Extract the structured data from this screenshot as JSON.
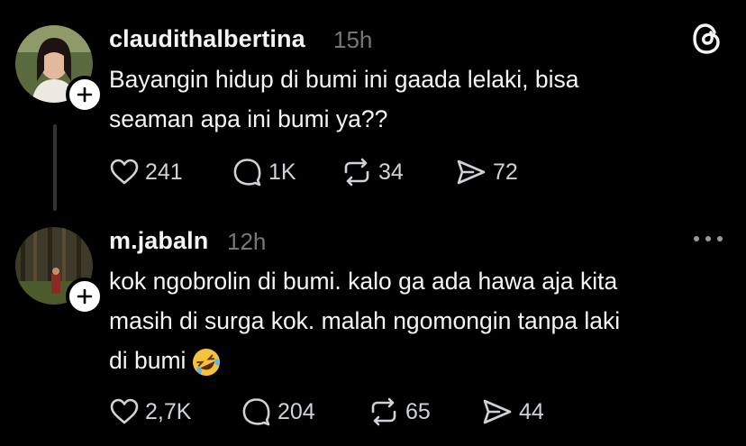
{
  "posts": [
    {
      "username": "claudithalbertina",
      "time": "15h",
      "text_lines": [
        "Bayangin hidup di bumi ini gaada lelaki, bisa",
        "seaman apa ini bumi ya??"
      ],
      "actions": {
        "likes": "241",
        "replies": "1K",
        "reposts": "34",
        "shares": "72"
      },
      "corner_icon": "threads-logo-icon"
    },
    {
      "username": "m.jabaln",
      "time": "12h",
      "text_lines": [
        "kok ngobrolin di bumi. kalo ga ada hawa aja kita",
        "masih di surga kok. malah ngomongin tanpa laki",
        "di bumi"
      ],
      "emoji": "rolling-on-floor-laughing",
      "actions": {
        "likes": "2,7K",
        "replies": "204",
        "reposts": "65",
        "shares": "44"
      },
      "corner_icon": "more-options-icon"
    }
  ],
  "colors": {
    "background": "#000000",
    "text": "#f3f5f7",
    "muted": "#777777",
    "thread_line": "#333333"
  }
}
